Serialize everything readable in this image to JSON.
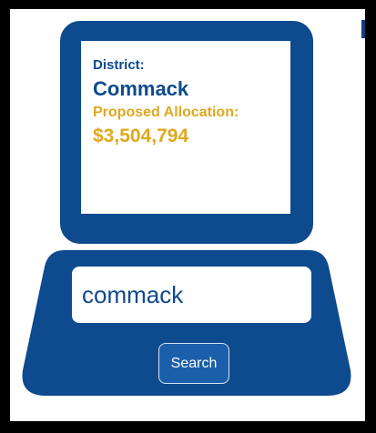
{
  "screen": {
    "district_label": "District:",
    "district_name": "Commack",
    "allocation_label": "Proposed Allocation:",
    "allocation_value": "$3,504,794"
  },
  "search": {
    "value": "commack",
    "button_label": "Search"
  },
  "colors": {
    "navy": "#0d4a8e",
    "gold": "#e0a81e",
    "button_blue": "#1b5fab"
  }
}
